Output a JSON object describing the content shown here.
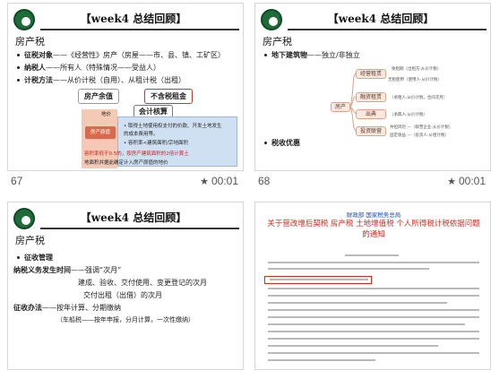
{
  "slides": [
    {
      "number": "67",
      "duration": "00:01",
      "title": "【week4 总结回顾】",
      "heading": "房产税",
      "lines": [
        {
          "label": "征税对象",
          "text": "——《经营性》房产（房屋——市、县、镇、工矿区）"
        },
        {
          "label": "纳税人",
          "text": "——所有人（特殊情况——受益人）"
        },
        {
          "label": "计税方法",
          "text": "——从价计税（自用）、从租计税（出租）"
        }
      ],
      "pills": [
        "房产余值",
        "不含税租金",
        "会计核算"
      ],
      "diagram_labels": [
        "地价",
        "房产原值"
      ],
      "box_lines": [
        "• 取得土地使用权支付的价款、开发土地发生",
        "  的成本费用等。",
        "• 容积率<建筑面积/宗地面积",
        "容积率低于0.5的，按房产建筑面积的2倍计算土",
        "地面积并据此确定计入房产原值的地价"
      ]
    },
    {
      "number": "68",
      "duration": "00:01",
      "title": "【week4 总结回顾】",
      "heading": "房产税",
      "lines": [
        {
          "label": "地下建筑物",
          "text": "——独立/非独立"
        },
        {
          "label": "税收优惠",
          "text": ""
        }
      ],
      "center_node": "房产",
      "nodes": [
        "经营租赁",
        "融资租赁",
        "出典",
        "投资联营"
      ],
      "leaves": [
        "免租期（出租方·从价计税）",
        "无租使用（使用人·从价计税）",
        "（承租人·从价计税，合同次月）",
        "（承典人·从价计税）",
        "共担风险 —（联营企业·从价计税）",
        "固定收益 —（投资人·从租计税）"
      ]
    },
    {
      "number": "",
      "duration": "",
      "title": "【week4 总结回顾】",
      "heading": "房产税",
      "lines": [
        {
          "label": "征收管理",
          "text": ""
        },
        {
          "label": "纳税义务发生时间",
          "text": "——强调“次月”"
        },
        {
          "label": "",
          "text": "建成、验收、交付使用、变更登记的次月"
        },
        {
          "label": "",
          "text": "交付出租（出借）的次月"
        },
        {
          "label": "征收办法",
          "text": "——按年计算、分期缴纳"
        },
        {
          "label": "",
          "text": "（车船税——按年申报，分月计算，一次性缴纳）"
        }
      ]
    },
    {
      "number": "",
      "duration": "",
      "doc_header": "财政部 国家税务总局",
      "doc_title": "关于营改增后契税 房产税 土地增值税 个人所得税计税依据问题的通知"
    }
  ]
}
